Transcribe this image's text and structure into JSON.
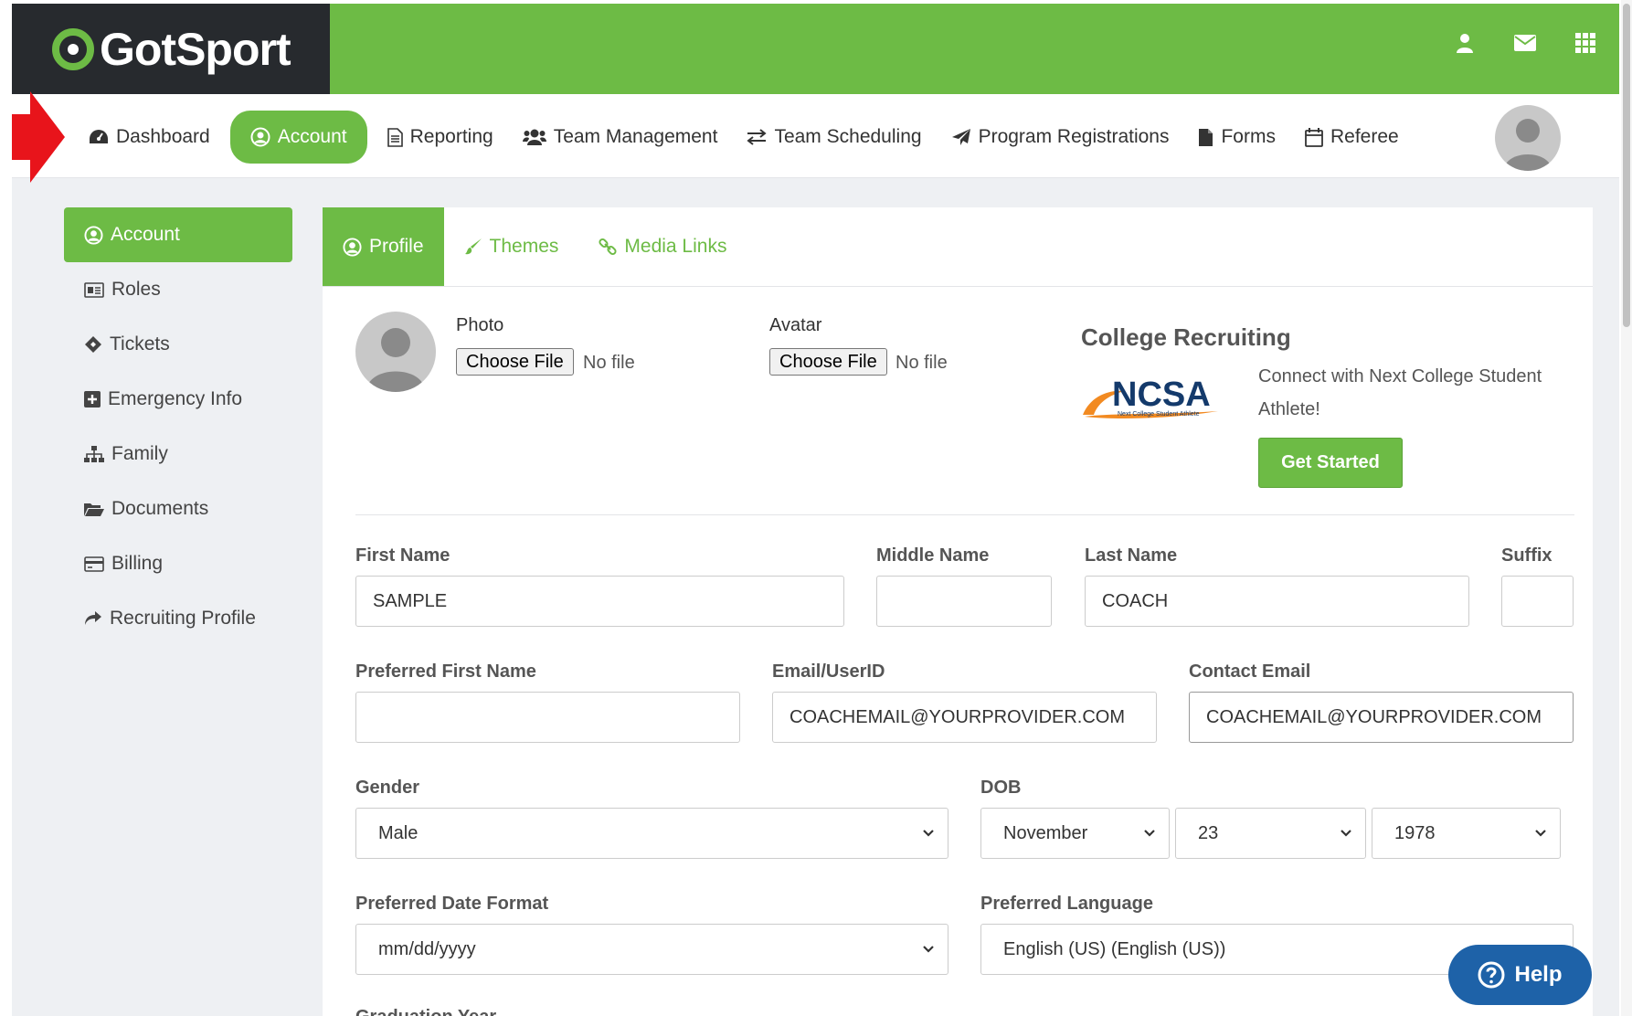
{
  "brand": {
    "name": "GotSport",
    "accent": "#6dbb45",
    "dark": "#272a2e"
  },
  "topbar": {
    "icons": [
      "user-icon",
      "envelope-icon",
      "grid-icon"
    ]
  },
  "nav": {
    "items": [
      {
        "label": "Dashboard",
        "icon": "dashboard-icon"
      },
      {
        "label": "Account",
        "icon": "user-circle-icon",
        "active": true
      },
      {
        "label": "Reporting",
        "icon": "file-icon"
      },
      {
        "label": "Team Management",
        "icon": "users-icon"
      },
      {
        "label": "Team Scheduling",
        "icon": "exchange-icon"
      },
      {
        "label": "Program Registrations",
        "icon": "paper-plane-icon"
      },
      {
        "label": "Forms",
        "icon": "document-icon"
      },
      {
        "label": "Referee",
        "icon": "calendar-icon"
      }
    ]
  },
  "sidebar": {
    "items": [
      {
        "label": "Account",
        "icon": "user-circle-icon",
        "active": true
      },
      {
        "label": "Roles",
        "icon": "id-card-icon"
      },
      {
        "label": "Tickets",
        "icon": "ticket-icon"
      },
      {
        "label": "Emergency Info",
        "icon": "plus-square-icon"
      },
      {
        "label": "Family",
        "icon": "sitemap-icon"
      },
      {
        "label": "Documents",
        "icon": "folder-open-icon"
      },
      {
        "label": "Billing",
        "icon": "credit-card-icon"
      },
      {
        "label": "Recruiting Profile",
        "icon": "share-icon"
      }
    ]
  },
  "tabs": [
    {
      "label": "Profile",
      "icon": "user-circle-icon",
      "active": true
    },
    {
      "label": "Themes",
      "icon": "brush-icon"
    },
    {
      "label": "Media Links",
      "icon": "link-icon"
    }
  ],
  "uploads": {
    "photo": {
      "label": "Photo",
      "button": "Choose File",
      "status": "No file"
    },
    "avatar": {
      "label": "Avatar",
      "button": "Choose File",
      "status": "No file"
    }
  },
  "college": {
    "title": "College Recruiting",
    "logo_text": "NCSA",
    "logo_tagline": "Next College Student Athlete",
    "text": "Connect with Next College Student Athlete!",
    "button": "Get Started"
  },
  "form": {
    "first_name": {
      "label": "First Name",
      "value": "SAMPLE"
    },
    "middle_name": {
      "label": "Middle Name",
      "value": ""
    },
    "last_name": {
      "label": "Last Name",
      "value": "COACH"
    },
    "suffix": {
      "label": "Suffix",
      "value": ""
    },
    "preferred_first_name": {
      "label": "Preferred First Name",
      "value": ""
    },
    "email": {
      "label": "Email/UserID",
      "value": "COACHEMAIL@YOURPROVIDER.COM"
    },
    "contact_email": {
      "label": "Contact Email",
      "value": "COACHEMAIL@YOURPROVIDER.COM"
    },
    "gender": {
      "label": "Gender",
      "value": "Male"
    },
    "dob": {
      "label": "DOB",
      "month": "November",
      "day": "23",
      "year": "1978"
    },
    "date_format": {
      "label": "Preferred Date Format",
      "value": "mm/dd/yyyy"
    },
    "language": {
      "label": "Preferred Language",
      "value": "English (US) (English (US))"
    },
    "graduation_year": {
      "label": "Graduation Year"
    }
  },
  "help": {
    "label": "Help"
  }
}
